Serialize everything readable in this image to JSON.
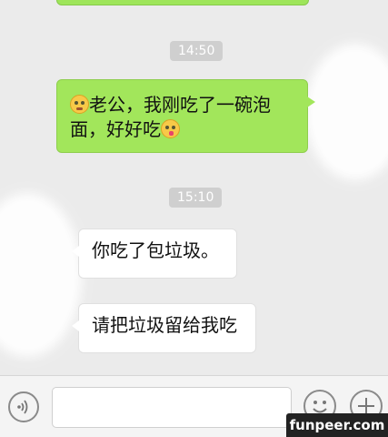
{
  "chat": {
    "timestamps": [
      "14:50",
      "15:10"
    ],
    "messages": [
      {
        "sender": "me",
        "text_line1": "老公，我刚吃了一碗泡",
        "text_line2": "面，好好吃",
        "emoji_before": "dizzy-face-icon",
        "emoji_after": "tongue-face-icon"
      },
      {
        "sender": "contact",
        "text": "你吃了包垃圾。"
      },
      {
        "sender": "contact",
        "text": "请把垃圾留给我吃"
      }
    ]
  },
  "input_bar": {
    "voice_icon": "voice-icon",
    "emoji_icon": "emoji-smile-icon",
    "plus_icon": "plus-icon",
    "value": ""
  },
  "watermark": "funpeer.com",
  "colors": {
    "my_bubble": "#a2e65b",
    "their_bubble": "#ffffff",
    "background": "#ebebeb"
  }
}
